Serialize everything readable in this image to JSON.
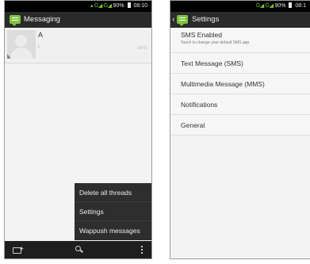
{
  "left": {
    "status": {
      "network": "G",
      "signal": "G",
      "battery": "90%",
      "time": "08:10"
    },
    "title": "Messaging",
    "thread": {
      "name": "A",
      "snippet": "c",
      "time": "08:05"
    },
    "menu": [
      "Delete all threads",
      "Settings",
      "Wappush messages"
    ],
    "bottom_icons": [
      "compose-icon",
      "search-icon",
      "overflow-icon"
    ]
  },
  "right": {
    "status": {
      "network": "G",
      "signal": "G",
      "battery": "90%",
      "time": "08:1"
    },
    "title": "Settings",
    "items": [
      {
        "title": "SMS Enabled",
        "subtitle": "Touch to change your default SMS app"
      },
      {
        "title": "Text Message (SMS)"
      },
      {
        "title": "Multimedia Message (MMS)"
      },
      {
        "title": "Notifications"
      },
      {
        "title": "General"
      }
    ]
  },
  "colors": {
    "accent": "#80c341",
    "actionbar": "#2a2a2a",
    "menu": "#2e2e2e"
  }
}
